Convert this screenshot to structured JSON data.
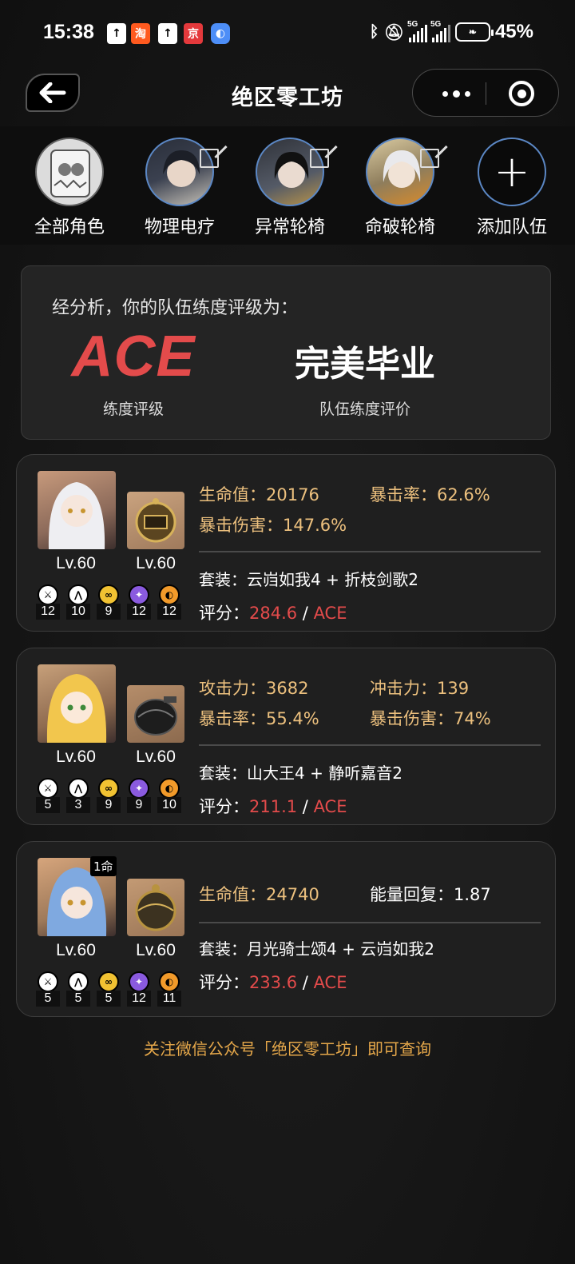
{
  "status_bar": {
    "time": "15:38",
    "battery": "45%",
    "network": "5G",
    "app_icons": [
      "upload-arrow",
      "taobao",
      "upload-arrow",
      "jingdong",
      "browser"
    ]
  },
  "header": {
    "title": "绝区零工坊"
  },
  "team_bar": {
    "items": [
      {
        "label": "全部角色"
      },
      {
        "label": "物理电疗"
      },
      {
        "label": "异常轮椅"
      },
      {
        "label": "命破轮椅"
      },
      {
        "label": "添加队伍"
      }
    ]
  },
  "rating": {
    "intro": "经分析，你的队伍练度评级为：",
    "grade": "ACE",
    "grade_label": "练度评级",
    "evaluation": "完美毕业",
    "evaluation_label": "队伍练度评价"
  },
  "characters": [
    {
      "level": "Lv.60",
      "engine_level": "Lv.60",
      "skills": [
        "12",
        "10",
        "9",
        "12",
        "12"
      ],
      "stat1_key": "生命值：",
      "stat1_val": "20176",
      "stat2_key": "暴击率：",
      "stat2_val": "62.6%",
      "stat3_key": "暴击伤害：",
      "stat3_val": "147.6%",
      "set": "套装：云岿如我4 + 折枝剑歌2",
      "score_label": "评分：",
      "score": "284.6",
      "grade": "ACE"
    },
    {
      "level": "Lv.60",
      "engine_level": "Lv.60",
      "skills": [
        "5",
        "3",
        "9",
        "9",
        "10"
      ],
      "stat1_key": "攻击力：",
      "stat1_val": "3682",
      "stat2_key": "冲击力：",
      "stat2_val": "139",
      "stat3_key": "暴击率：",
      "stat3_val": "55.4%",
      "stat4_key": "暴击伤害：",
      "stat4_val": "74%",
      "set": "套装：山大王4 + 静听嘉音2",
      "score_label": "评分：",
      "score": "211.1",
      "grade": "ACE"
    },
    {
      "badge": "1命",
      "level": "Lv.60",
      "engine_level": "Lv.60",
      "skills": [
        "5",
        "5",
        "5",
        "12",
        "11"
      ],
      "stat1_key": "生命值：",
      "stat1_val": "24740",
      "stat2_key": "能量回复：",
      "stat2_val": "1.87",
      "set": "套装：月光骑士颂4 + 云岿如我2",
      "score_label": "评分：",
      "score": "233.6",
      "grade": "ACE"
    }
  ],
  "footer": {
    "note": "关注微信公众号「绝区零工坊」即可查询"
  },
  "colors": {
    "accent_red": "#e34b4b",
    "stat_gold": "#ecc07e",
    "footer_gold": "#e6a84a",
    "avatar_ring": "#5b87c4"
  }
}
